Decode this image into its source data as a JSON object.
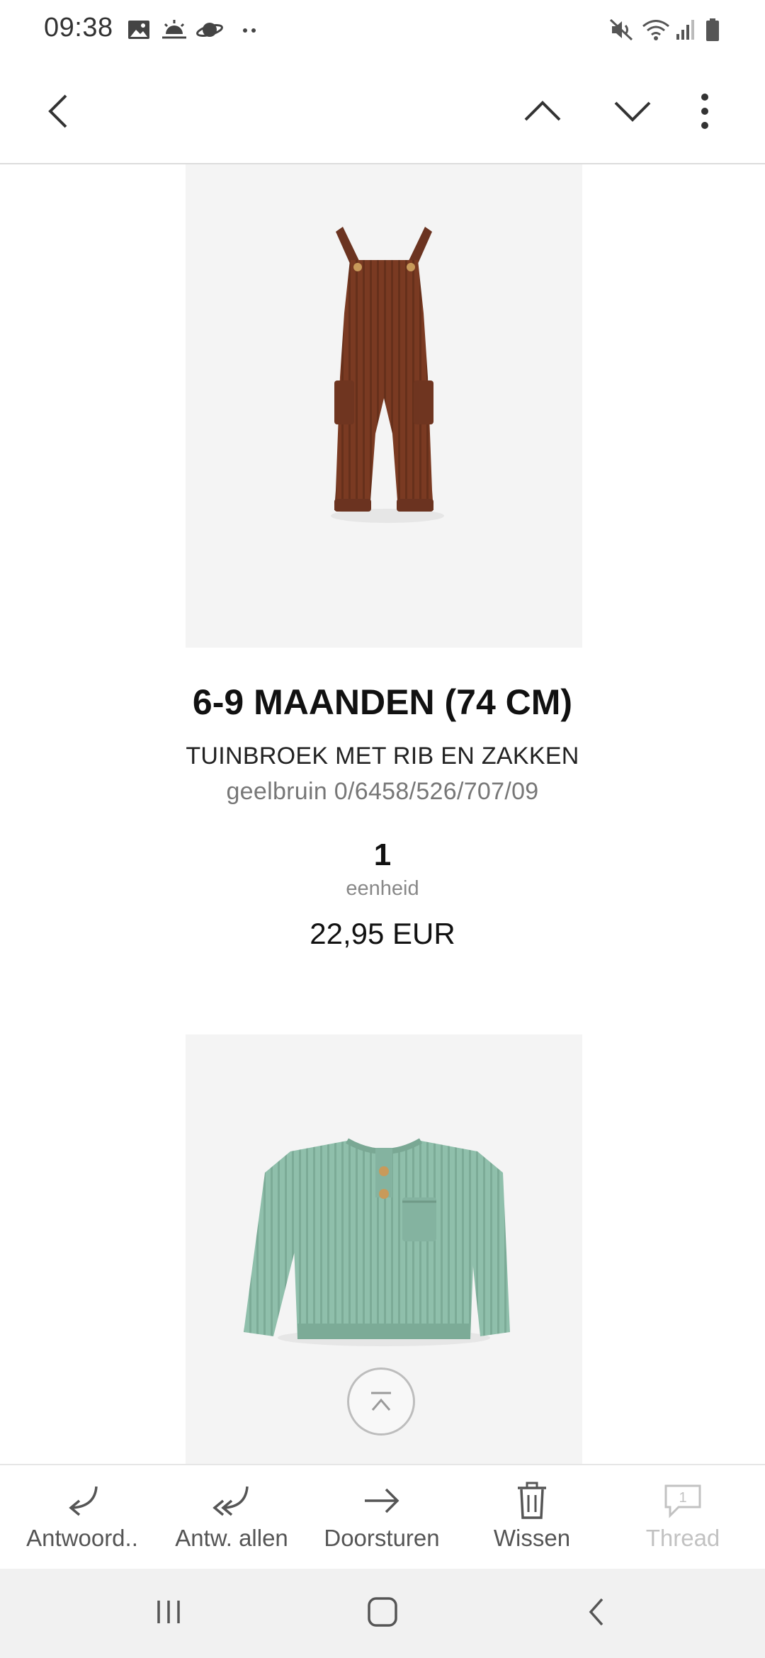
{
  "status_bar": {
    "time": "09:38",
    "left_icons": [
      "gallery-icon",
      "weather-icon",
      "planet-icon",
      "more-dots-icon"
    ],
    "right_icons": [
      "mute-icon",
      "wifi-icon",
      "signal-icon",
      "battery-icon"
    ]
  },
  "top_bar": {
    "icons": [
      "back-arrow-icon",
      "chevron-up-icon",
      "chevron-down-icon",
      "overflow-menu-icon"
    ]
  },
  "products": [
    {
      "size": "6-9 MAANDEN (74 CM)",
      "name": "TUINBROEK MET RIB EN ZAKKEN",
      "color_ref": "geelbruin 0/6458/526/707/09",
      "quantity": "1",
      "unit": "eenheid",
      "price": "22,95 EUR",
      "image": "rust-brown-ribbed-dungarees"
    },
    {
      "image": "mint-green-knit-sweater"
    }
  ],
  "actions": [
    {
      "label": "Antwoord..",
      "icon": "reply-icon",
      "enabled": true
    },
    {
      "label": "Antw. allen",
      "icon": "reply-all-icon",
      "enabled": true
    },
    {
      "label": "Doorsturen",
      "icon": "forward-arrow-icon",
      "enabled": true
    },
    {
      "label": "Wissen",
      "icon": "trash-icon",
      "enabled": true
    },
    {
      "label": "Thread",
      "icon": "thread-bubble-icon",
      "badge": "1",
      "enabled": false
    }
  ],
  "nav_bar": {
    "icons": [
      "recents-icon",
      "home-icon",
      "nav-back-icon"
    ]
  },
  "colors": {
    "background": "#ffffff",
    "image_bg": "#f4f4f4",
    "divider": "#dcdcdc",
    "nav_bar_bg": "#f1f1f1",
    "dungarees": "#7a3a22",
    "sweater": "#8fbfab",
    "disabled_text": "#c2c2c2"
  }
}
